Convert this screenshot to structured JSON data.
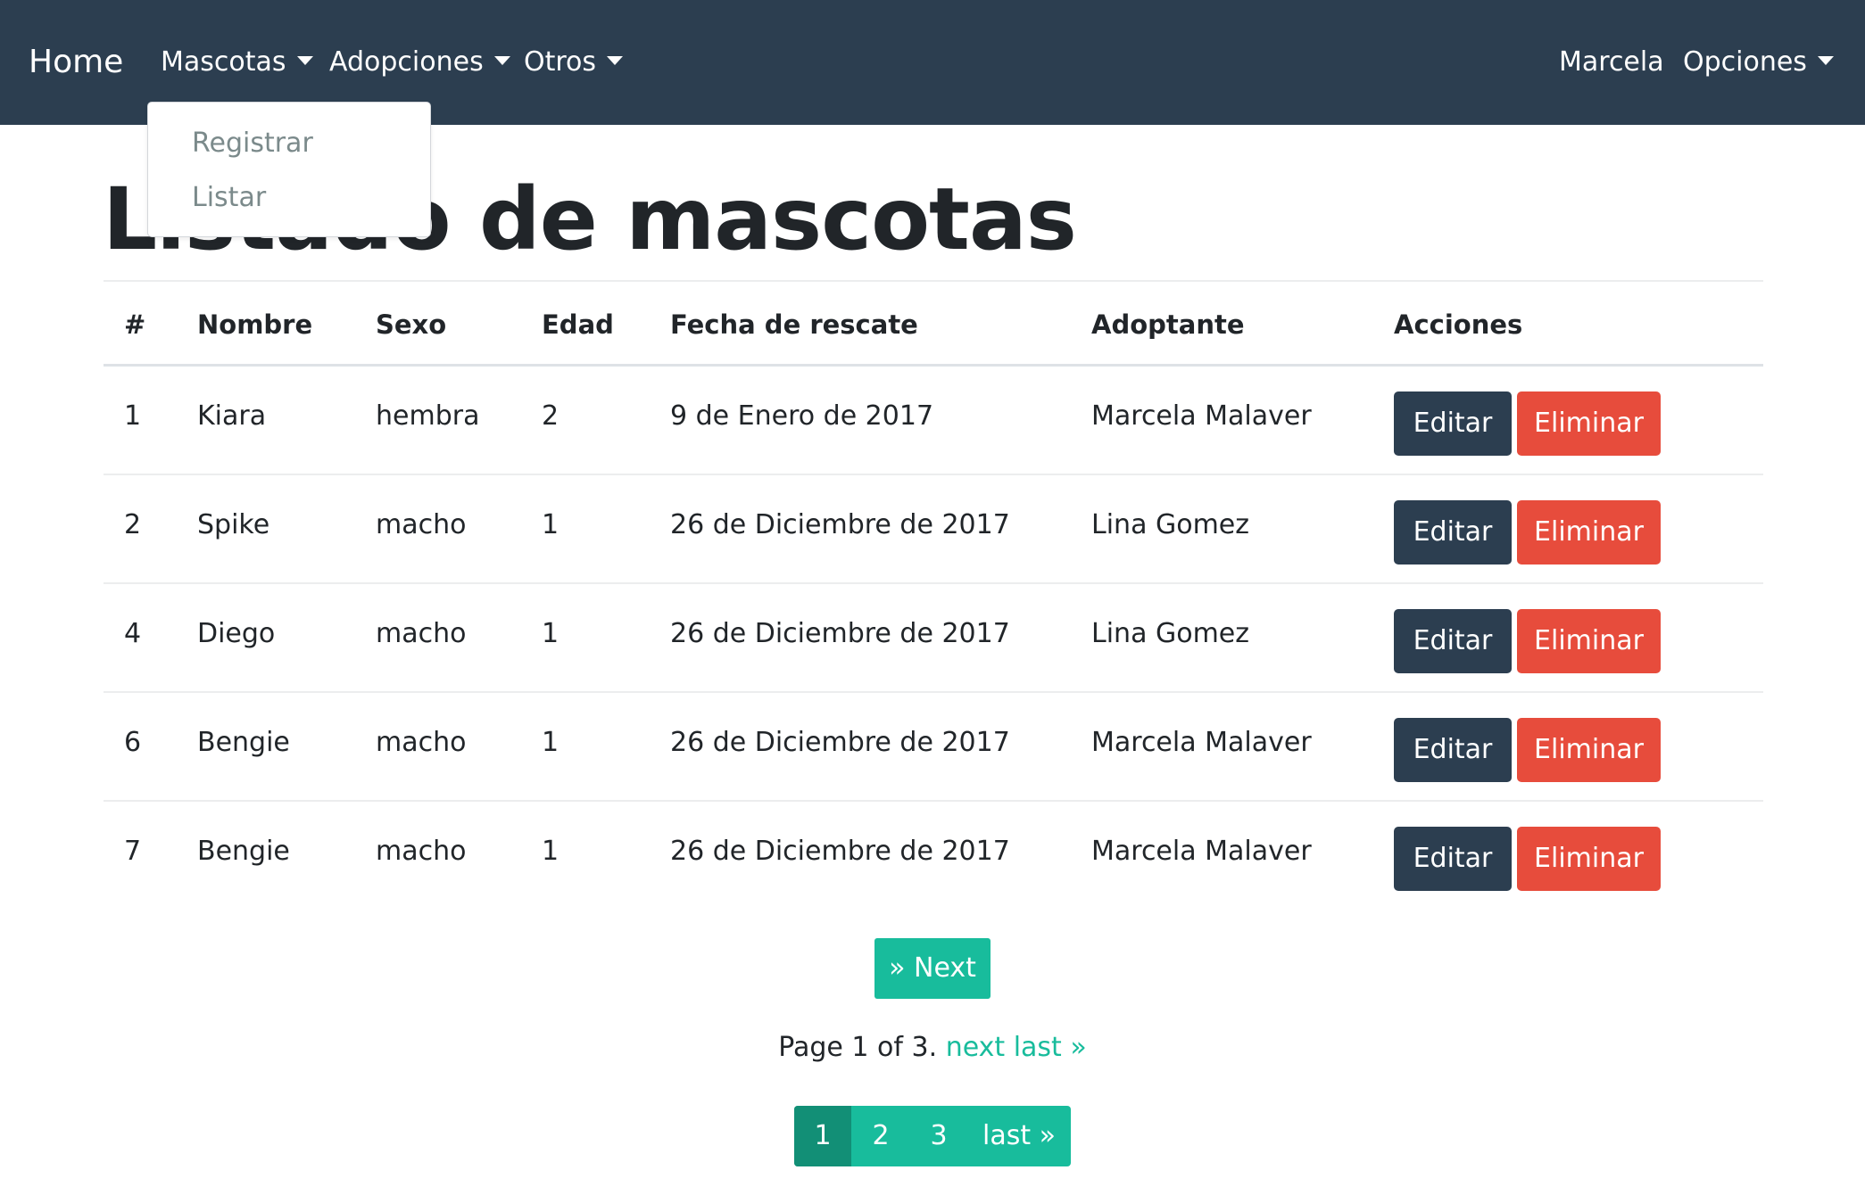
{
  "navbar": {
    "brand": "Home",
    "menus": [
      {
        "label": "Mascotas"
      },
      {
        "label": "Adopciones"
      },
      {
        "label": "Otros"
      }
    ],
    "user": "Marcela",
    "options": "Opciones"
  },
  "dropdown": {
    "items": [
      {
        "label": "Registrar"
      },
      {
        "label": "Listar"
      }
    ]
  },
  "page": {
    "title": "Listado de mascotas"
  },
  "table": {
    "headers": [
      "#",
      "Nombre",
      "Sexo",
      "Edad",
      "Fecha de rescate",
      "Adoptante",
      "Acciones"
    ],
    "rows": [
      {
        "id": "1",
        "nombre": "Kiara",
        "sexo": "hembra",
        "edad": "2",
        "fecha": "9 de Enero de 2017",
        "adoptante": "Marcela Malaver"
      },
      {
        "id": "2",
        "nombre": "Spike",
        "sexo": "macho",
        "edad": "1",
        "fecha": "26 de Diciembre de 2017",
        "adoptante": "Lina Gomez"
      },
      {
        "id": "4",
        "nombre": "Diego",
        "sexo": "macho",
        "edad": "1",
        "fecha": "26 de Diciembre de 2017",
        "adoptante": "Lina Gomez"
      },
      {
        "id": "6",
        "nombre": "Bengie",
        "sexo": "macho",
        "edad": "1",
        "fecha": "26 de Diciembre de 2017",
        "adoptante": "Marcela Malaver"
      },
      {
        "id": "7",
        "nombre": "Bengie",
        "sexo": "macho",
        "edad": "1",
        "fecha": "26 de Diciembre de 2017",
        "adoptante": "Marcela Malaver"
      }
    ],
    "edit_label": "Editar",
    "delete_label": "Eliminar"
  },
  "pagination": {
    "next_button": "» Next",
    "info_prefix": "Page 1 of 3.",
    "info_next": "next",
    "info_last": "last »",
    "pages": [
      "1",
      "2",
      "3"
    ],
    "last_label": "last »",
    "current_page": "1"
  },
  "colors": {
    "navbar": "#2c3e50",
    "primary": "#2c3e50",
    "danger": "#e74c3c",
    "success": "#18bc9c",
    "success_active": "#128f76"
  }
}
